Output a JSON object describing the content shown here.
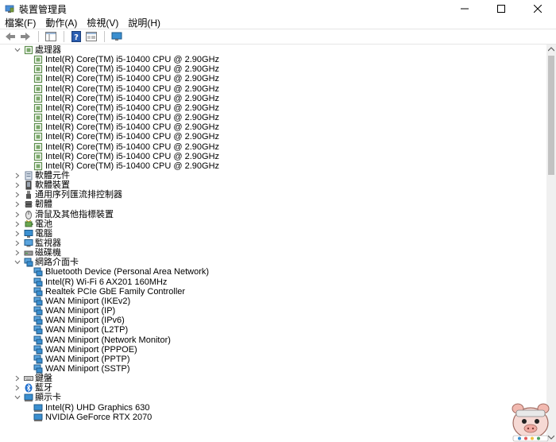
{
  "window": {
    "title": "裝置管理員"
  },
  "menu": [
    "檔案(F)",
    "動作(A)",
    "檢視(V)",
    "說明(H)"
  ],
  "tree": [
    {
      "level": 1,
      "expanded": true,
      "icon": "cpu-icon",
      "label": "處理器"
    },
    {
      "level": 2,
      "icon": "cpu-icon",
      "label": "Intel(R) Core(TM) i5-10400 CPU @ 2.90GHz"
    },
    {
      "level": 2,
      "icon": "cpu-icon",
      "label": "Intel(R) Core(TM) i5-10400 CPU @ 2.90GHz"
    },
    {
      "level": 2,
      "icon": "cpu-icon",
      "label": "Intel(R) Core(TM) i5-10400 CPU @ 2.90GHz"
    },
    {
      "level": 2,
      "icon": "cpu-icon",
      "label": "Intel(R) Core(TM) i5-10400 CPU @ 2.90GHz"
    },
    {
      "level": 2,
      "icon": "cpu-icon",
      "label": "Intel(R) Core(TM) i5-10400 CPU @ 2.90GHz"
    },
    {
      "level": 2,
      "icon": "cpu-icon",
      "label": "Intel(R) Core(TM) i5-10400 CPU @ 2.90GHz"
    },
    {
      "level": 2,
      "icon": "cpu-icon",
      "label": "Intel(R) Core(TM) i5-10400 CPU @ 2.90GHz"
    },
    {
      "level": 2,
      "icon": "cpu-icon",
      "label": "Intel(R) Core(TM) i5-10400 CPU @ 2.90GHz"
    },
    {
      "level": 2,
      "icon": "cpu-icon",
      "label": "Intel(R) Core(TM) i5-10400 CPU @ 2.90GHz"
    },
    {
      "level": 2,
      "icon": "cpu-icon",
      "label": "Intel(R) Core(TM) i5-10400 CPU @ 2.90GHz"
    },
    {
      "level": 2,
      "icon": "cpu-icon",
      "label": "Intel(R) Core(TM) i5-10400 CPU @ 2.90GHz"
    },
    {
      "level": 2,
      "icon": "cpu-icon",
      "label": "Intel(R) Core(TM) i5-10400 CPU @ 2.90GHz"
    },
    {
      "level": 1,
      "expanded": false,
      "icon": "software-component-icon",
      "label": "軟體元件"
    },
    {
      "level": 1,
      "expanded": false,
      "icon": "software-device-icon",
      "label": "軟體裝置"
    },
    {
      "level": 1,
      "expanded": false,
      "icon": "usb-icon",
      "label": "通用序列匯流排控制器"
    },
    {
      "level": 1,
      "expanded": false,
      "icon": "firmware-icon",
      "label": "韌體"
    },
    {
      "level": 1,
      "expanded": false,
      "icon": "mouse-icon",
      "label": "滑鼠及其他指標裝置"
    },
    {
      "level": 1,
      "expanded": false,
      "icon": "battery-icon",
      "label": "電池"
    },
    {
      "level": 1,
      "expanded": false,
      "icon": "computer-icon",
      "label": "電腦"
    },
    {
      "level": 1,
      "expanded": false,
      "icon": "monitor-icon",
      "label": "監視器"
    },
    {
      "level": 1,
      "expanded": false,
      "icon": "disk-drive-icon",
      "label": "磁碟機"
    },
    {
      "level": 1,
      "expanded": true,
      "icon": "network-adapter-icon",
      "label": "網路介面卡"
    },
    {
      "level": 2,
      "icon": "network-adapter-icon",
      "label": "Bluetooth Device (Personal Area Network)"
    },
    {
      "level": 2,
      "icon": "network-adapter-icon",
      "label": "Intel(R) Wi-Fi 6 AX201 160MHz"
    },
    {
      "level": 2,
      "icon": "network-adapter-icon",
      "label": "Realtek PCIe GbE Family Controller"
    },
    {
      "level": 2,
      "icon": "network-adapter-icon",
      "label": "WAN Miniport (IKEv2)"
    },
    {
      "level": 2,
      "icon": "network-adapter-icon",
      "label": "WAN Miniport (IP)"
    },
    {
      "level": 2,
      "icon": "network-adapter-icon",
      "label": "WAN Miniport (IPv6)"
    },
    {
      "level": 2,
      "icon": "network-adapter-icon",
      "label": "WAN Miniport (L2TP)"
    },
    {
      "level": 2,
      "icon": "network-adapter-icon",
      "label": "WAN Miniport (Network Monitor)"
    },
    {
      "level": 2,
      "icon": "network-adapter-icon",
      "label": "WAN Miniport (PPPOE)"
    },
    {
      "level": 2,
      "icon": "network-adapter-icon",
      "label": "WAN Miniport (PPTP)"
    },
    {
      "level": 2,
      "icon": "network-adapter-icon",
      "label": "WAN Miniport (SSTP)"
    },
    {
      "level": 1,
      "expanded": false,
      "icon": "keyboard-icon",
      "label": "鍵盤"
    },
    {
      "level": 1,
      "expanded": false,
      "icon": "bluetooth-icon",
      "label": "藍牙"
    },
    {
      "level": 1,
      "expanded": true,
      "icon": "display-adapter-icon",
      "label": "顯示卡"
    },
    {
      "level": 2,
      "icon": "display-adapter-icon",
      "label": "Intel(R) UHD Graphics 630"
    },
    {
      "level": 2,
      "icon": "display-adapter-icon",
      "label": "NVIDIA GeForce RTX 2070"
    }
  ],
  "colors": {
    "cpu": "#5f8f4e",
    "network": "#3a8fd0",
    "text": "#000000"
  }
}
